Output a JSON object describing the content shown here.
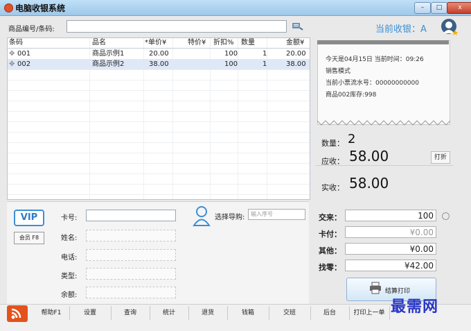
{
  "window": {
    "title": "电脑收银系统",
    "min": "–",
    "max": "□",
    "close": "x"
  },
  "search": {
    "label": "商品编号/条码:",
    "value": ""
  },
  "cashier": {
    "label": "当前收银：A"
  },
  "table": {
    "headers": [
      "条码",
      "品名",
      "*单价¥",
      "特价¥",
      "折扣%",
      "数量",
      "金额¥"
    ],
    "rows": [
      [
        "001",
        "商品示例1",
        "20.00",
        "",
        "100",
        "1",
        "20.00"
      ],
      [
        "002",
        "商品示例2",
        "38.00",
        "",
        "100",
        "1",
        "38.00"
      ]
    ],
    "selected_row": 1
  },
  "receipt": {
    "line1": "今天是04月15日 当前时间：09:26",
    "line2": "销售模式",
    "line3": "当前小票流水号：00000000000",
    "line4": "商品002库存:998"
  },
  "summary": {
    "qty_label": "数量：",
    "qty_value": "2",
    "due_label": "应收：",
    "due_value": "58.00",
    "discount_btn": "打折",
    "paid_label": "实收：",
    "paid_value": "58.00"
  },
  "member": {
    "vip": "VIP",
    "member_btn": "会员 F8",
    "card_label": "卡号:",
    "card_value": "",
    "name_label": "姓名:",
    "phone_label": "电话:",
    "type_label": "类型:",
    "balance_label": "余额:",
    "guide_label": "选择导购:",
    "guide_placeholder": "输入序号"
  },
  "payment": {
    "tender_label": "交来：",
    "tender_value": "100",
    "card_label": "卡付：",
    "card_value": "¥0.00",
    "other_label": "其他：",
    "other_value": "¥0.00",
    "change_label": "找零：",
    "change_value": "¥42.00",
    "settle_label": "结算打印"
  },
  "bottom_buttons": [
    "帮助F1",
    "设置",
    "查询",
    "统计",
    "退货",
    "钱箱",
    "交班",
    "后台",
    "打印上一单"
  ],
  "watermark": "最需网"
}
